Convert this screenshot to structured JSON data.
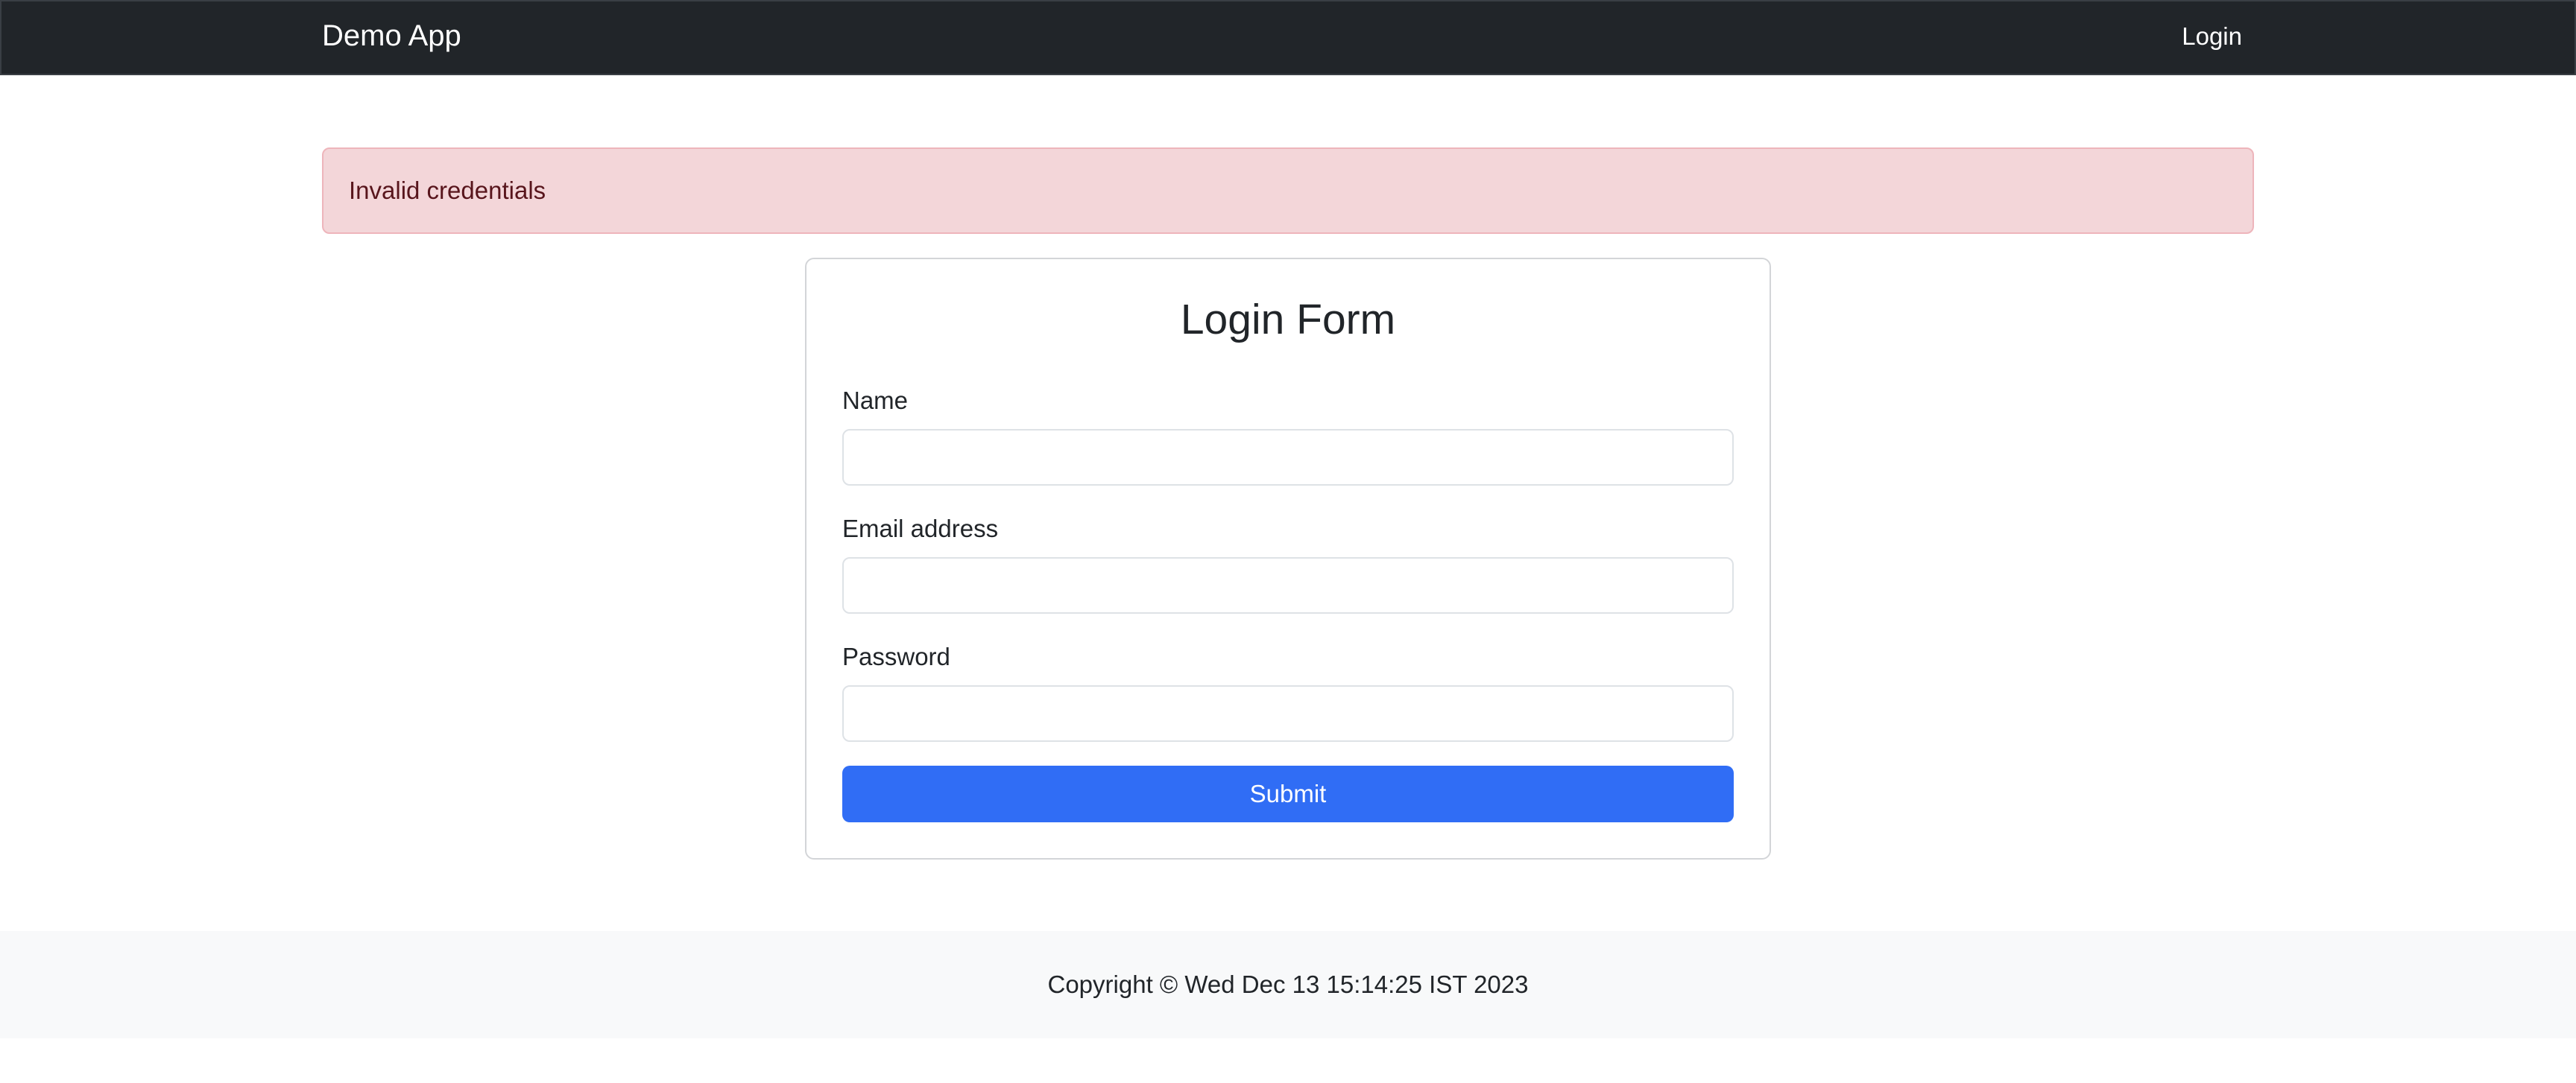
{
  "navbar": {
    "brand": "Demo App",
    "login_link": "Login"
  },
  "alert": {
    "message": "Invalid credentials",
    "type": "danger"
  },
  "login_form": {
    "title": "Login Form",
    "fields": [
      {
        "label": "Name",
        "value": "",
        "placeholder": ""
      },
      {
        "label": "Email address",
        "value": "",
        "placeholder": ""
      },
      {
        "label": "Password",
        "value": "",
        "placeholder": ""
      }
    ],
    "submit_label": "Submit"
  },
  "footer": {
    "copyright": "Copyright © Wed Dec 13 15:14:25 IST 2023"
  },
  "colors": {
    "navbar_bg": "#212529",
    "alert_bg": "#f3d6d9",
    "alert_border": "#eeb5bb",
    "alert_text": "#58151c",
    "primary_button": "#306df5",
    "footer_bg": "#f8f9fa"
  }
}
